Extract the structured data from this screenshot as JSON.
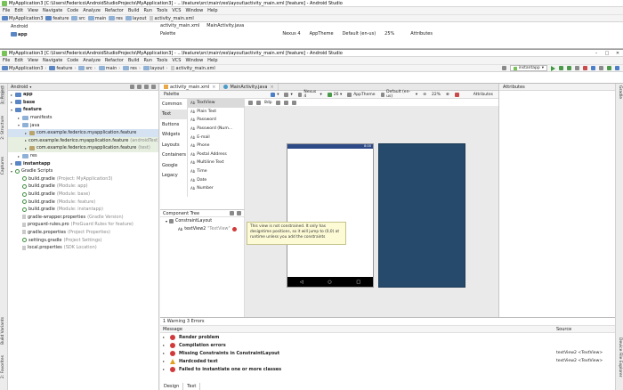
{
  "back_window": {
    "title": "MyApplication3 [C:\\Users\\Federico\\AndroidStudioProjects\\MyApplication3] - ...\\feature\\src\\main\\res\\layout\\activity_main.xml [feature] - Android Studio",
    "menu": [
      "File",
      "Edit",
      "View",
      "Navigate",
      "Code",
      "Analyze",
      "Refactor",
      "Build",
      "Run",
      "Tools",
      "VCS",
      "Window",
      "Help"
    ],
    "breadcrumbs": [
      "MyApplication3",
      "feature",
      "src",
      "main",
      "res",
      "layout",
      "activity_main.xml"
    ],
    "tree_header": "Android",
    "tree_first": "app",
    "tabs": [
      "activity_main.xml",
      "MainActivity.java"
    ],
    "palette_label": "Palette",
    "device": "Nexus 4",
    "theme": "AppTheme",
    "locale": "Default (en-us)",
    "zoom": "25%",
    "attributes_label": "Attributes"
  },
  "window": {
    "title": "MyApplication3 [C:\\Users\\Federico\\AndroidStudioProjects\\MyApplication3] - ...\\feature\\src\\main\\res\\layout\\activity_main.xml [feature] - Android Studio",
    "menu": [
      "File",
      "Edit",
      "View",
      "Navigate",
      "Code",
      "Analyze",
      "Refactor",
      "Build",
      "Run",
      "Tools",
      "VCS",
      "Window",
      "Help"
    ],
    "breadcrumbs": [
      "MyApplication3",
      "feature",
      "src",
      "main",
      "res",
      "layout",
      "activity_main.xml"
    ],
    "run_config": "instantapp"
  },
  "side_tabs": {
    "left": [
      "1: Project",
      "2: Structure",
      "Captures",
      "Build Variants",
      "2: Favorites"
    ],
    "right": [
      "Gradle",
      "Device File Explorer"
    ]
  },
  "project": {
    "header": "Android",
    "tree": [
      {
        "label": "app",
        "note": "",
        "depth": 0,
        "arrow": "▸",
        "icon": "folder-bold",
        "bold": true
      },
      {
        "label": "base",
        "note": "",
        "depth": 0,
        "arrow": "▸",
        "icon": "folder-bold",
        "bold": true
      },
      {
        "label": "feature",
        "note": "",
        "depth": 0,
        "arrow": "▾",
        "icon": "folder-bold",
        "bold": true
      },
      {
        "label": "manifests",
        "note": "",
        "depth": 1,
        "arrow": "▸",
        "icon": "folder"
      },
      {
        "label": "java",
        "note": "",
        "depth": 1,
        "arrow": "▾",
        "icon": "folder"
      },
      {
        "label": "com.example.federico.myapplication.feature",
        "note": "",
        "depth": 2,
        "arrow": "▸",
        "icon": "package",
        "state": "sel"
      },
      {
        "label": "com.example.federico.myapplication.feature",
        "note": "(androidTest)",
        "depth": 2,
        "arrow": "▸",
        "icon": "package",
        "state": "hl"
      },
      {
        "label": "com.example.federico.myapplication.feature",
        "note": "(test)",
        "depth": 2,
        "arrow": "▸",
        "icon": "package",
        "state": "hl"
      },
      {
        "label": "res",
        "note": "",
        "depth": 1,
        "arrow": "▸",
        "icon": "folder"
      },
      {
        "label": "instantapp",
        "note": "",
        "depth": 0,
        "arrow": "▸",
        "icon": "folder-bold",
        "bold": true
      },
      {
        "label": "Gradle Scripts",
        "note": "",
        "depth": 0,
        "arrow": "▾",
        "icon": "gradle"
      },
      {
        "label": "build.gradle",
        "note": "(Project: MyApplication3)",
        "depth": 1,
        "arrow": "",
        "icon": "gradle"
      },
      {
        "label": "build.gradle",
        "note": "(Module: app)",
        "depth": 1,
        "arrow": "",
        "icon": "gradle"
      },
      {
        "label": "build.gradle",
        "note": "(Module: base)",
        "depth": 1,
        "arrow": "",
        "icon": "gradle"
      },
      {
        "label": "build.gradle",
        "note": "(Module: feature)",
        "depth": 1,
        "arrow": "",
        "icon": "gradle"
      },
      {
        "label": "build.gradle",
        "note": "(Module: instantapp)",
        "depth": 1,
        "arrow": "",
        "icon": "gradle"
      },
      {
        "label": "gradle-wrapper.properties",
        "note": "(Gradle Version)",
        "depth": 1,
        "arrow": "",
        "icon": "file"
      },
      {
        "label": "proguard-rules.pro",
        "note": "(ProGuard Rules for feature)",
        "depth": 1,
        "arrow": "",
        "icon": "file"
      },
      {
        "label": "gradle.properties",
        "note": "(Project Properties)",
        "depth": 1,
        "arrow": "",
        "icon": "file"
      },
      {
        "label": "settings.gradle",
        "note": "(Project Settings)",
        "depth": 1,
        "arrow": "",
        "icon": "gradle"
      },
      {
        "label": "local.properties",
        "note": "(SDK Location)",
        "depth": 1,
        "arrow": "",
        "icon": "file"
      }
    ]
  },
  "editor": {
    "tabs": [
      "activity_main.xml",
      "MainActivity.java"
    ],
    "palette_label": "Palette",
    "device": "Nexus 4",
    "api": "26",
    "theme": "AppTheme",
    "locale": "Default (en-us)",
    "zoom": "22%",
    "attributes_label": "Attributes",
    "margin_value": "8dp",
    "categories": [
      "Common",
      "Text",
      "Buttons",
      "Widgets",
      "Layouts",
      "Containers",
      "Google",
      "Legacy"
    ],
    "selected_category": 1,
    "palette_items": [
      "TextView",
      "Plain Text",
      "Password",
      "Password (Num...",
      "E-mail",
      "Phone",
      "Postal Address",
      "Multiline Text",
      "Time",
      "Date",
      "Number"
    ],
    "component_tree_label": "Component Tree",
    "tree_root": "ConstraintLayout",
    "tree_child": "textView2",
    "tree_child_value": "\"TextView\"",
    "tooltip": "This view is not constrained. It only has designtime positions, so it will jump to (0,0) at runtime unless you add the constraints",
    "phone_time": "8:00",
    "nav_buttons": [
      "◁",
      "○",
      "□"
    ]
  },
  "messages": {
    "summary": "1 Warning 3 Errors",
    "col_message": "Message",
    "col_source": "Source",
    "rows": [
      {
        "text": "Render problem",
        "source": "",
        "kind": "error"
      },
      {
        "text": "Compilation errors",
        "source": "",
        "kind": "error"
      },
      {
        "text": "Missing Constraints in ConstraintLayout",
        "source": "textView2 <TextView>",
        "kind": "error"
      },
      {
        "text": "Hardcoded text",
        "source": "textView2 <TextView>",
        "kind": "warning"
      },
      {
        "text": "Failed to instantiate one or more classes",
        "source": "",
        "kind": "error"
      }
    ],
    "bottom_tabs": [
      "Design",
      "Text"
    ]
  },
  "colors": {
    "blueprint": "#254a6b",
    "status_bar": "#2d4a86",
    "error": "#d03a3a",
    "warning": "#e0a020",
    "run_green": "#3a9a3a"
  }
}
